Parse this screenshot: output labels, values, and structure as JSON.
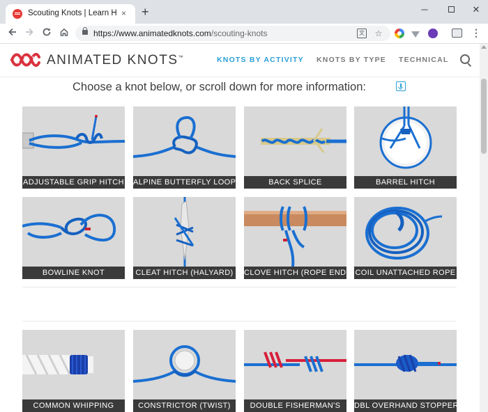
{
  "browser": {
    "tab_title": "Scouting Knots | Learn How to",
    "tab_close": "×",
    "new_tab": "+",
    "url_host": "https://www.animatedknots.com",
    "url_path": "/scouting-knots",
    "min": "─",
    "close": "✕",
    "menu": "⋮"
  },
  "site": {
    "logo": "ANIMATED KNOTS",
    "logo_tm": "™",
    "nav": {
      "activity": "KNOTS BY ACTIVITY",
      "type": "KNOTS BY TYPE",
      "technical": "TECHNICAL"
    }
  },
  "intro": "Choose a knot below, or scroll down for more information:",
  "knots": [
    {
      "label": "ADJUSTABLE GRIP HITCH",
      "icon": "adjustable-grip-hitch-image"
    },
    {
      "label": "ALPINE BUTTERFLY LOOP",
      "icon": "alpine-butterfly-loop-image"
    },
    {
      "label": "BACK SPLICE",
      "icon": "back-splice-image"
    },
    {
      "label": "BARREL HITCH",
      "icon": "barrel-hitch-image"
    },
    {
      "label": "BOWLINE KNOT",
      "icon": "bowline-knot-image"
    },
    {
      "label": "CLEAT HITCH (HALYARD)",
      "icon": "cleat-hitch-image"
    },
    {
      "label": "CLOVE HITCH (ROPE END)",
      "icon": "clove-hitch-image"
    },
    {
      "label": "COIL UNATTACHED ROPE",
      "icon": "coil-unattached-rope-image"
    },
    {
      "label": "COMMON WHIPPING",
      "icon": "common-whipping-image"
    },
    {
      "label": "CONSTRICTOR (TWIST)",
      "icon": "constrictor-image"
    },
    {
      "label": "DOUBLE FISHERMAN'S",
      "icon": "double-fishermans-image"
    },
    {
      "label": "DBL OVERHAND STOPPER",
      "icon": "double-overhand-stopper-image"
    }
  ],
  "colors": {
    "rope_blue": "#1a6fd1",
    "accent": "#2a9fd8",
    "logo_red": "#d9333f",
    "label_bg": "#3a3a3a",
    "card_bg": "#d9d9d9"
  }
}
